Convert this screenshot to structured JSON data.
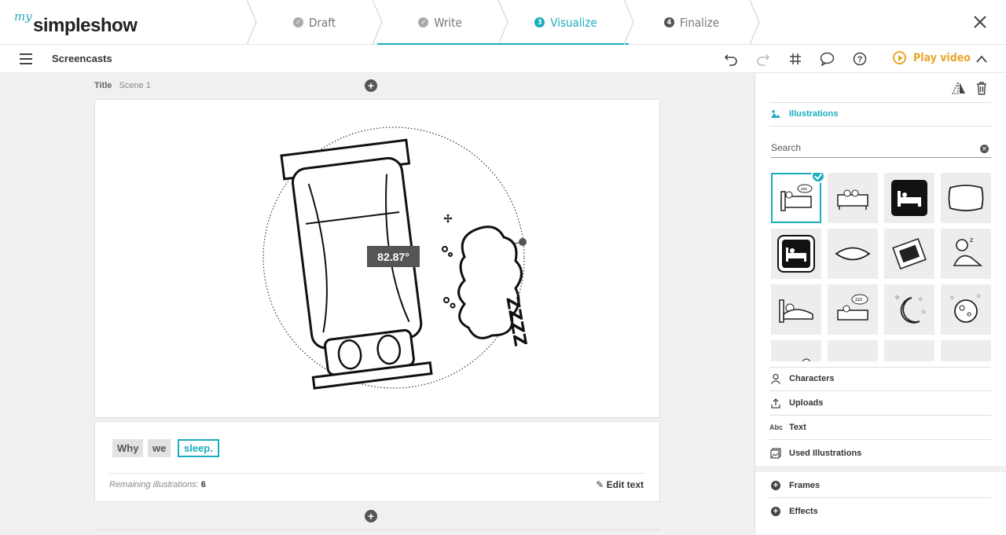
{
  "app": {
    "logo_prefix": "my",
    "logo_main": "simpleshow"
  },
  "steps": [
    {
      "label": "Draft",
      "state": "done",
      "marker": "check"
    },
    {
      "label": "Write",
      "state": "done",
      "marker": "check"
    },
    {
      "label": "Visualize",
      "state": "active",
      "marker": "3"
    },
    {
      "label": "Finalize",
      "state": "todo",
      "marker": "4"
    }
  ],
  "toolbar": {
    "project_title": "Screencasts",
    "play_label": "Play video",
    "icons": [
      "undo-icon",
      "redo-icon",
      "grid-icon",
      "comment-icon",
      "help-icon",
      "chevron-up-icon"
    ]
  },
  "scene": {
    "title_label": "Title",
    "title_value": "Scene 1",
    "rotation_label": "82.87°",
    "words": [
      {
        "text": "Why",
        "highlighted": false
      },
      {
        "text": "we",
        "highlighted": false
      },
      {
        "text": "sleep.",
        "highlighted": true
      }
    ],
    "remaining_label": "Remaining illustrations:",
    "remaining_count": "6",
    "edit_text_label": "Edit text"
  },
  "panel": {
    "illustrations_label": "Illustrations",
    "search_placeholder": "Search",
    "thumbnails": [
      "bed-sleeping-icon",
      "bed-couple-icon",
      "bed-sign-icon",
      "pillow-icon",
      "bed-sign-icon",
      "pillow-flat-icon",
      "bed-top-view-icon",
      "person-snoring-icon",
      "person-in-bed-icon",
      "bed-zzz-icon",
      "moon-stars-icon",
      "moon-icon",
      "bed-sleeping-icon",
      "dark-circle-icon",
      "striped-icon",
      "striped-icon"
    ],
    "characters_label": "Characters",
    "uploads_label": "Uploads",
    "text_label": "Text",
    "text_icon_label": "Abc",
    "used_label": "Used Illustrations",
    "frames_label": "Frames",
    "effects_label": "Effects"
  },
  "colors": {
    "accent": "#19aebd",
    "play": "#e9a42a"
  }
}
